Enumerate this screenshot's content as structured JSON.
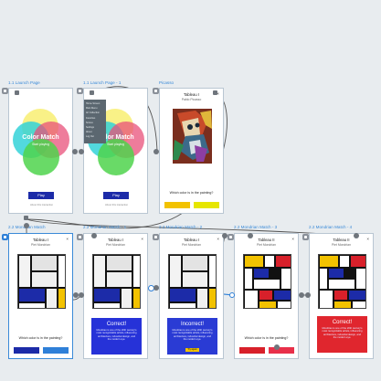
{
  "flow": {
    "labels": [
      "1.1 Launch Page",
      "1.1 Launch Page - 1",
      "Picasso",
      "2.2 Mondrian Match",
      "2.2 Mondrian Match - 1",
      "2.2 Mondrian Match - 2",
      "2.2 Mondrian Match - 3",
      "2.2 Mondrian Match - 4"
    ]
  },
  "launch": {
    "title": "Color Match",
    "subtitle": "Start playing",
    "play_label": "Play",
    "footer": "About this interaction"
  },
  "launch1": {
    "menu_items": [
      "Home Screen",
      "Main Menu",
      "Art Collection",
      "Favorites",
      "Scores",
      "Settings",
      "About",
      "Log Out"
    ]
  },
  "picasso": {
    "title": "Tableau I",
    "subtitle": "Pablo Picasso",
    "question": "Which color is in the painting?",
    "close": "×"
  },
  "mondrian": {
    "title": "Tableau I",
    "subtitle": "Piet Mondrian",
    "question": "Which color is in the painting?",
    "close": "×"
  },
  "mondrian1": {
    "title": "Tableau I",
    "subtitle": "Piet Mondrian",
    "modal_title": "Correct!",
    "modal_body": "Mondrian is one of the 20th century's most recognizable artists, influencing architecture, industrial design, and the modern eye.",
    "close": "×"
  },
  "mondrian2": {
    "title": "Tableau I",
    "subtitle": "Piet Mondrian",
    "modal_title": "Incorrect!",
    "modal_body": "Mondrian is one of the 20th century's most recognizable artists, influencing architecture, industrial design, and the modern eye.",
    "modal_button": "Try again",
    "close": "×"
  },
  "mondrian3": {
    "title": "Tableau II",
    "subtitle": "Piet Mondrian",
    "question": "Which color is in the painting?",
    "close": "×"
  },
  "mondrian4": {
    "title": "Tableau II",
    "subtitle": "Piet Mondrian",
    "modal_title": "Correct!",
    "modal_body": "Mondrian is one of the 20th century's most recognizable artists, influencing architecture, industrial design, and the modern eye.",
    "close": "×"
  },
  "colors": {
    "accent": "#3a8ad8",
    "mondrian_blue": "#1c2ba8",
    "mondrian_red": "#d8202a",
    "mondrian_yellow": "#f2c200",
    "correct_blue": "#2632d8",
    "incorrect_blue": "#2a3bd4",
    "correct_red": "#e0262e"
  }
}
